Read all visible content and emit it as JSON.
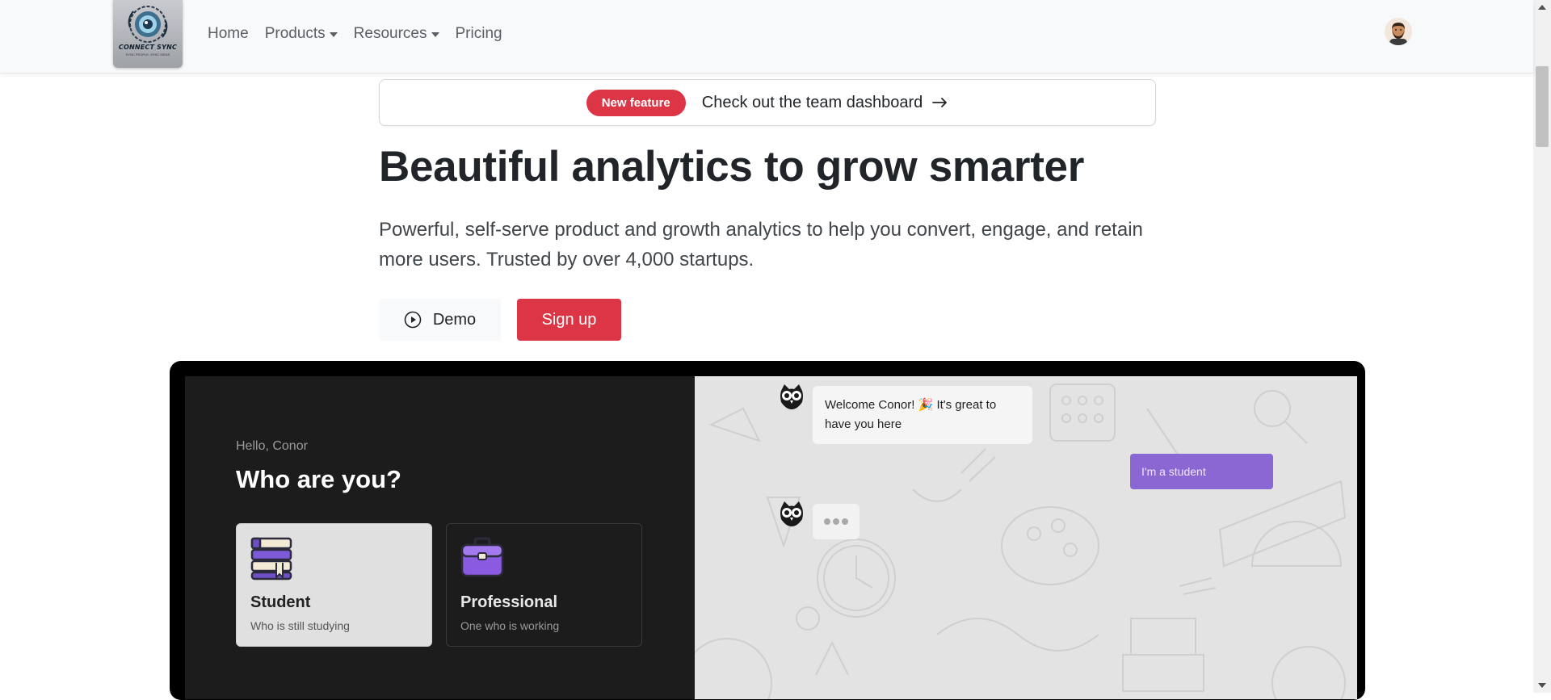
{
  "navbar": {
    "logo_text": "CONNECT SYNC",
    "logo_subtext": "SYNC PEOPLE, SYNC IDEAS",
    "links": [
      {
        "label": "Home",
        "dropdown": false
      },
      {
        "label": "Products",
        "dropdown": true
      },
      {
        "label": "Resources",
        "dropdown": true
      },
      {
        "label": "Pricing",
        "dropdown": false
      }
    ],
    "avatar_icon": "user-avatar-icon"
  },
  "hero": {
    "badge": "New feature",
    "announcement": "Check out the team dashboard",
    "title": "Beautiful analytics to grow smarter",
    "lead": "Powerful, self-serve product and growth analytics to help you convert, engage, and retain more users. Trusted by over 4,000 startups.",
    "demo_label": "Demo",
    "signup_label": "Sign up"
  },
  "mockup": {
    "greeting": "Hello, Conor",
    "question": "Who are you?",
    "cards": [
      {
        "title": "Student",
        "subtitle": "Who is still studying"
      },
      {
        "title": "Professional",
        "subtitle": "One who is working"
      }
    ],
    "chat": {
      "bot_message": "Welcome Conor! 🎉 It's great to have you here",
      "user_message": "I'm a student"
    }
  },
  "colors": {
    "accent_red": "#dc3545",
    "navbar_bg": "#f8f9fa",
    "chat_user_bubble": "#8b67d3",
    "dark_panel": "#1c1c1c"
  }
}
